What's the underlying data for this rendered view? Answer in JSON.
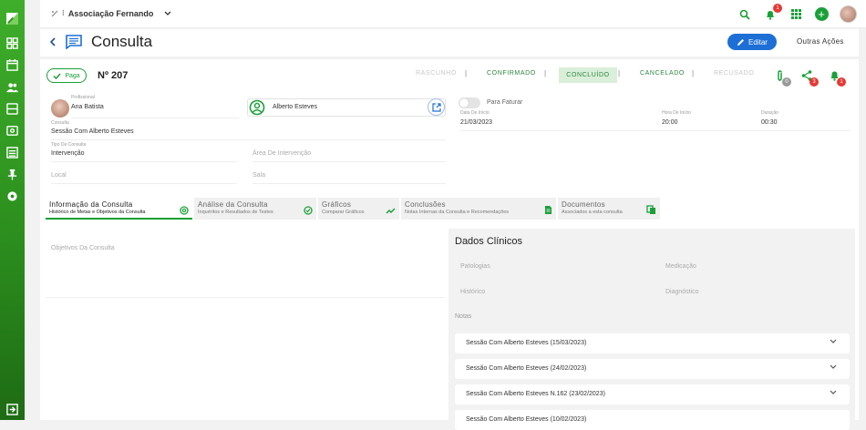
{
  "topbar": {
    "org_name": "Associação Fernando",
    "notifications_badge": "1"
  },
  "header": {
    "title": "Consulta",
    "edit_label": "Editar",
    "more_label": "Outras Ações"
  },
  "record": {
    "paid_label": "Paga",
    "number": "Nº 207",
    "statuses": [
      "RASCUNHO",
      "CONFIRMADO",
      "CONCLUÍDO",
      "CANCELADO",
      "RECUSADO"
    ],
    "active_status": "CONCLUÍDO",
    "attachments_count": "0",
    "shares_count": "3",
    "alerts_count": "1"
  },
  "form": {
    "professional_label": "Profissional",
    "professional_value": "Ana Batista",
    "patient_value": "Alberto Esteves",
    "invoice_label": "Para Faturar",
    "consulta_label": "Consulta",
    "consulta_value": "Sessão Com Alberto Esteves",
    "type_label": "Tipo De Consulta",
    "type_value": "Intervenção",
    "area_placeholder": "Área De Intervenção",
    "local_placeholder": "Local",
    "room_placeholder": "Sala",
    "start_date_label": "Data De Início",
    "start_date_value": "21/03/2023",
    "start_time_label": "Hora De Início",
    "start_time_value": "20:00",
    "duration_label": "Duração",
    "duration_value": "00:30"
  },
  "tabs": [
    {
      "title": "Informação da Consulta",
      "subtitle": "Histórico de Metas e Objetivos da Consulta"
    },
    {
      "title": "Análise da Consulta",
      "subtitle": "Inquéritos e Resultados de Testes"
    },
    {
      "title": "Gráficos",
      "subtitle": "Comparar Gráficos"
    },
    {
      "title": "Conclusões",
      "subtitle": "Notas Internas da Consulta e Recomendações"
    },
    {
      "title": "Documentos",
      "subtitle": "Associados a esta consulta"
    }
  ],
  "left_pane": {
    "objectives_placeholder": "Objetivos Da Consulta"
  },
  "clinical": {
    "title": "Dados Clínicos",
    "pathologies": "Patologias",
    "medication": "Medicação",
    "history": "Histórico",
    "diagnosis": "Diagnóstico",
    "notes": "Notas",
    "sessions": [
      "Sessão Com Alberto Esteves (15/03/2023)",
      "Sessão Com Alberto Esteves (24/02/2023)",
      "Sessão Com Alberto Esteves N.162 (23/02/2023)",
      "Sessão Com Alberto Esteves (10/02/2023)"
    ]
  },
  "colors": {
    "brand_green": "#1aa038",
    "primary_blue": "#1d6fd6",
    "badge_red": "#e53935"
  }
}
